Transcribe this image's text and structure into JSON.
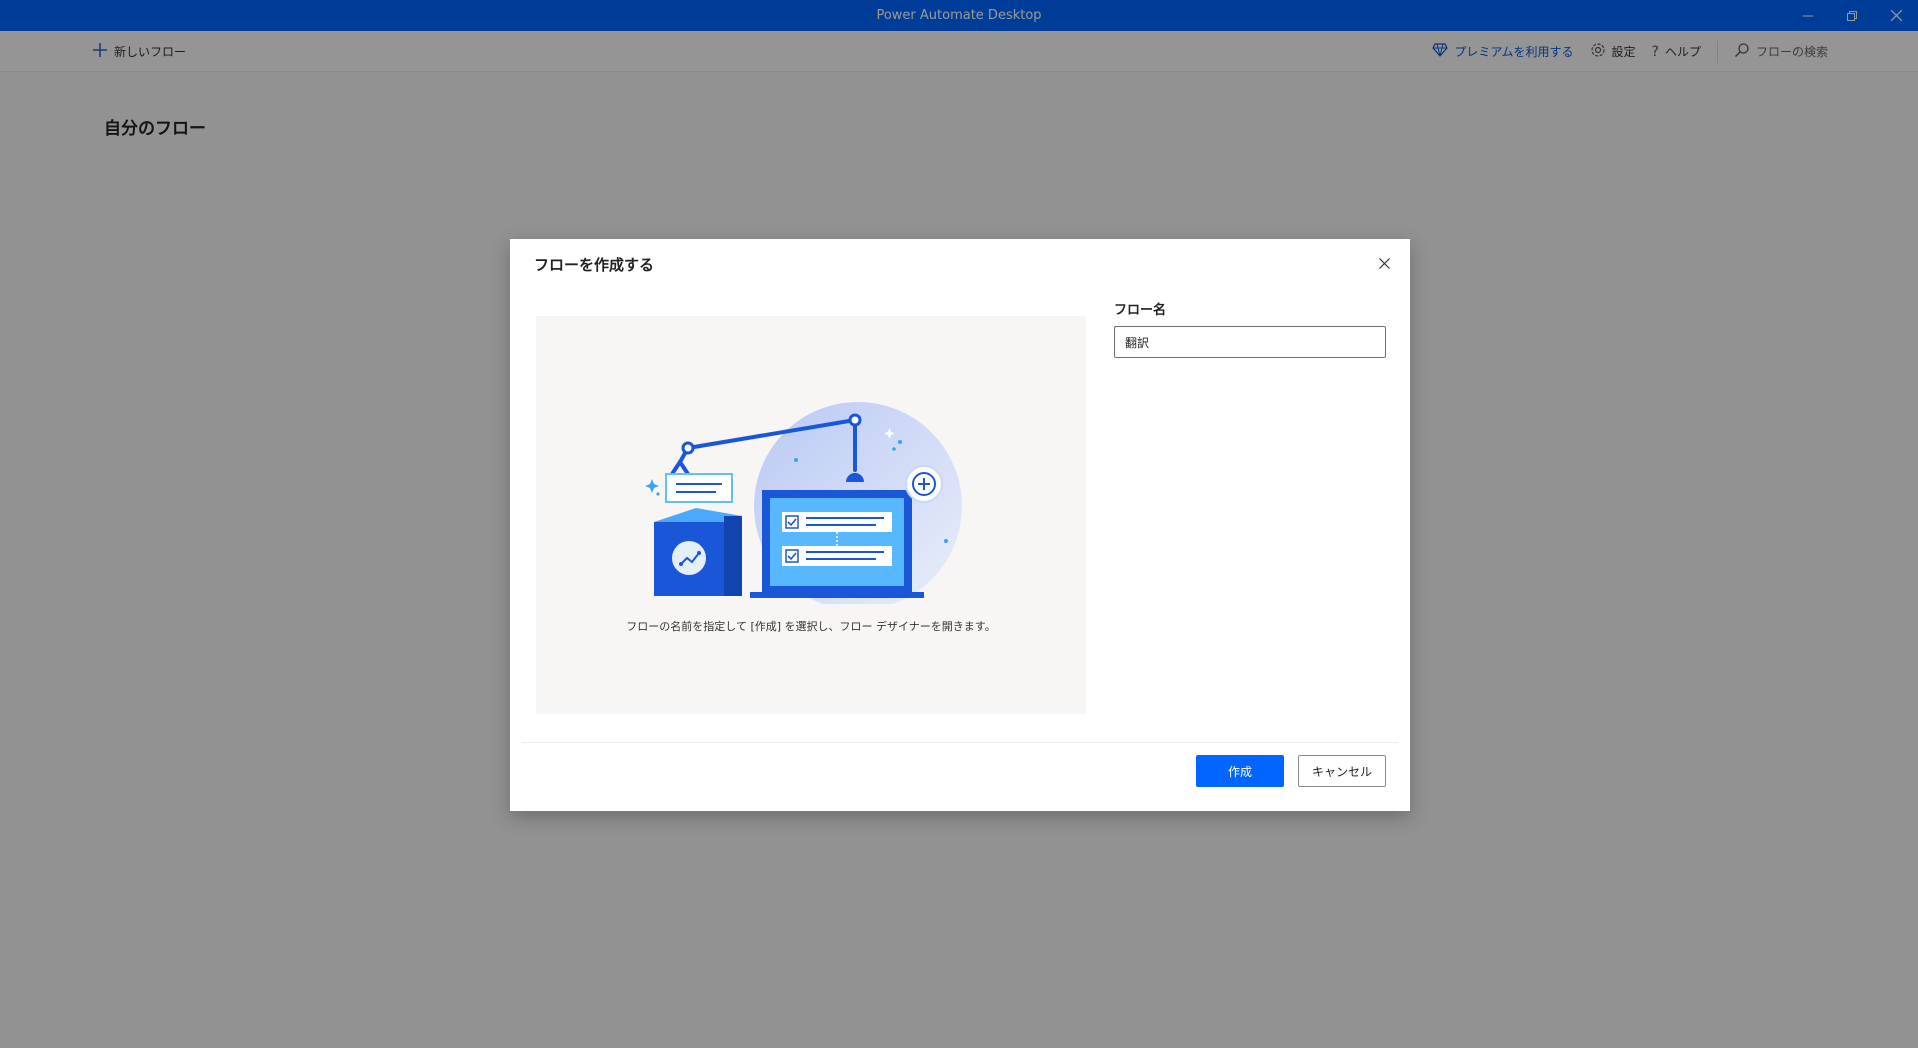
{
  "window": {
    "title": "Power Automate Desktop",
    "controls": [
      "minimize-icon",
      "restore-icon",
      "close-icon"
    ]
  },
  "toolbar": {
    "new_flow_label": "新しいフロー",
    "premium_label": "プレミアムを利用する",
    "settings_label": "設定",
    "help_label": "ヘルプ",
    "search_label": "フローの検索"
  },
  "main": {
    "title": "自分のフロー"
  },
  "dialog": {
    "title": "フローを作成する",
    "caption": "フローの名前を指定して [作成] を選択し、フロー デザイナーを開きます。",
    "field_label": "フロー名",
    "field_value": "翻訳",
    "create_label": "作成",
    "cancel_label": "キャンセル"
  },
  "colors": {
    "accent": "#0066ff",
    "premium": "#0b5ad1",
    "overlay": "rgba(0,0,0,0.40)"
  }
}
